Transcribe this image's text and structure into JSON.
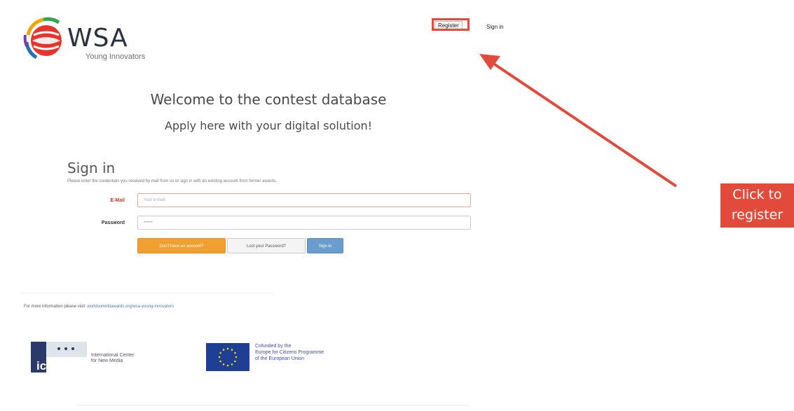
{
  "logo": {
    "brand": "WSA",
    "subtitle": "Young Innovators"
  },
  "nav": {
    "register": "Register",
    "signin": "Sign in"
  },
  "headings": {
    "welcome": "Welcome to the contest database",
    "apply": "Apply here with your digital solution!"
  },
  "signin": {
    "title": "Sign in",
    "description": "Please enter the credentials you received by mail from us or sign in with an existing account from former awards.",
    "email_label": "E-Mail",
    "email_placeholder": "Your e-mail",
    "password_label": "Password",
    "password_placeholder": "••••••",
    "buttons": {
      "no_account": "Don't have an account?",
      "lost_password": "Lost your Password?",
      "signin": "Sign in"
    }
  },
  "footer": {
    "more_info_prefix": "For more information please visit:",
    "more_info_link": "worldsummitawards.org/wsa-young-innovators",
    "icnm": {
      "mark": "icnm",
      "name_line1": "International Center",
      "name_line2": "for New Media"
    },
    "eu": {
      "line1": "Cofunded by the",
      "line2": "Europe for Citizens Programme",
      "line3": "of the European Union"
    }
  },
  "annotation": {
    "line1": "Click to",
    "line2": "register",
    "color": "#e24a3b"
  }
}
